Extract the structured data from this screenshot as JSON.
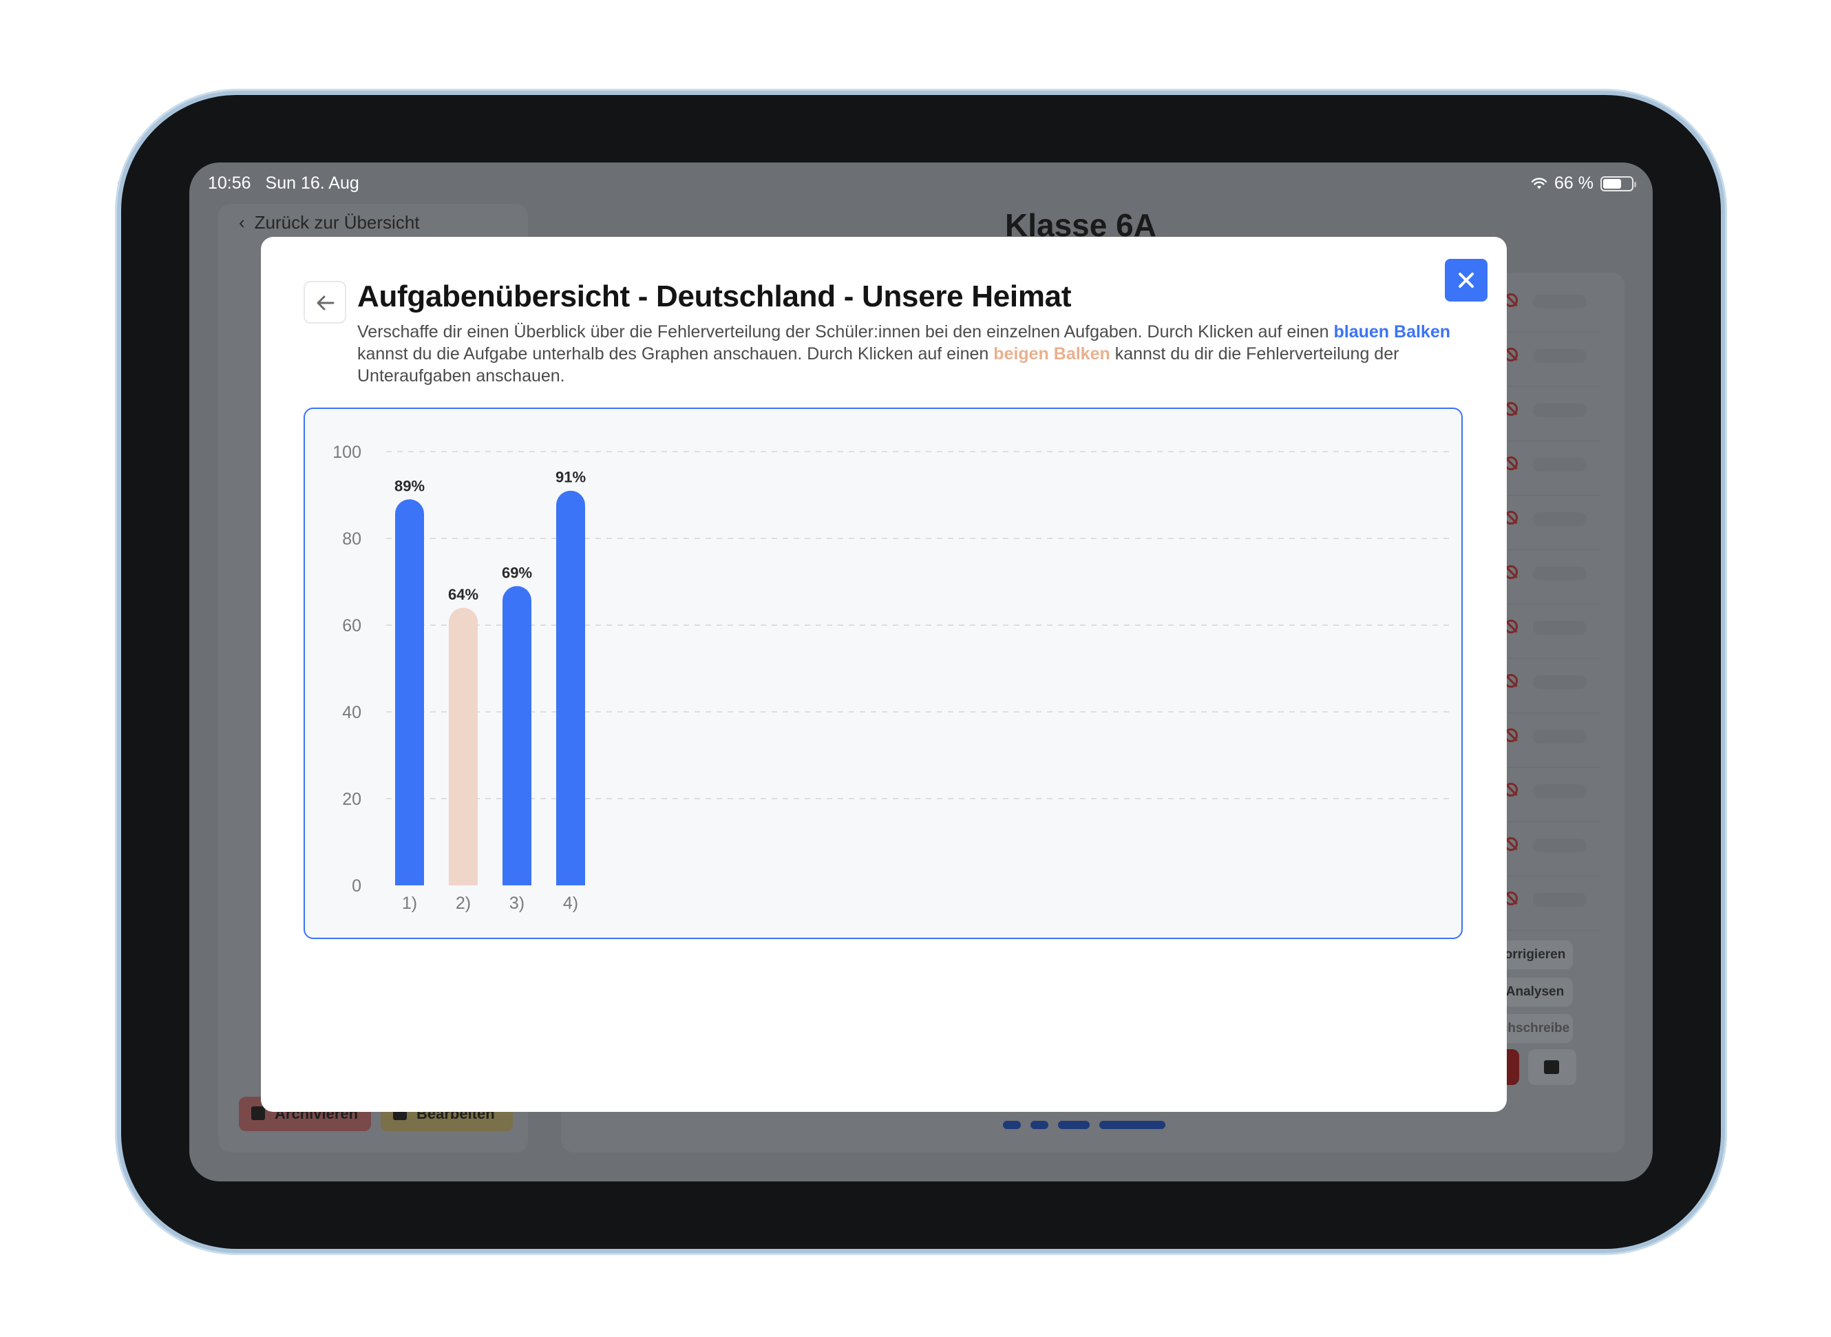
{
  "status_bar": {
    "time": "10:56",
    "date": "Sun 16. Aug",
    "battery_text": "66 %",
    "battery_level": 0.66
  },
  "background_app": {
    "back_link": "Zurück zur Übersicht",
    "title": "Klasse 6A",
    "side_buttons": [
      "orrigieren",
      "Analysen",
      "chschreibe"
    ],
    "archive_label": "Archivieren",
    "edit_label": "Bearbeiten"
  },
  "modal": {
    "title": "Aufgabenübersicht - Deutschland - Unsere Heimat",
    "desc_part1": "Verschaffe dir einen Überblick über die Fehlerverteilung der Schüler:innen bei den einzelnen Aufgaben. Durch Klicken auf einen ",
    "desc_blue": "blauen Balken",
    "desc_part2": " kannst du die Aufgabe unterhalb des Graphen anschauen. Durch Klicken auf einen ",
    "desc_beige": "beigen Balken",
    "desc_part3": " kannst du dir die Fehlerverteilung der Unteraufgaben anschauen."
  },
  "colors": {
    "accent": "#3b74f6",
    "beige": "#f0d5c9",
    "beige_text": "#eab08d"
  },
  "chart_data": {
    "type": "bar",
    "categories": [
      "1)",
      "2)",
      "3)",
      "4)"
    ],
    "values": [
      89,
      64,
      69,
      91
    ],
    "labels": [
      "89%",
      "64%",
      "69%",
      "91%"
    ],
    "bar_colors": [
      "#3b74f6",
      "#f0d5c9",
      "#3b74f6",
      "#3b74f6"
    ],
    "ylim": [
      0,
      100
    ],
    "yticks": [
      0,
      20,
      40,
      60,
      80,
      100
    ],
    "grid": true
  }
}
